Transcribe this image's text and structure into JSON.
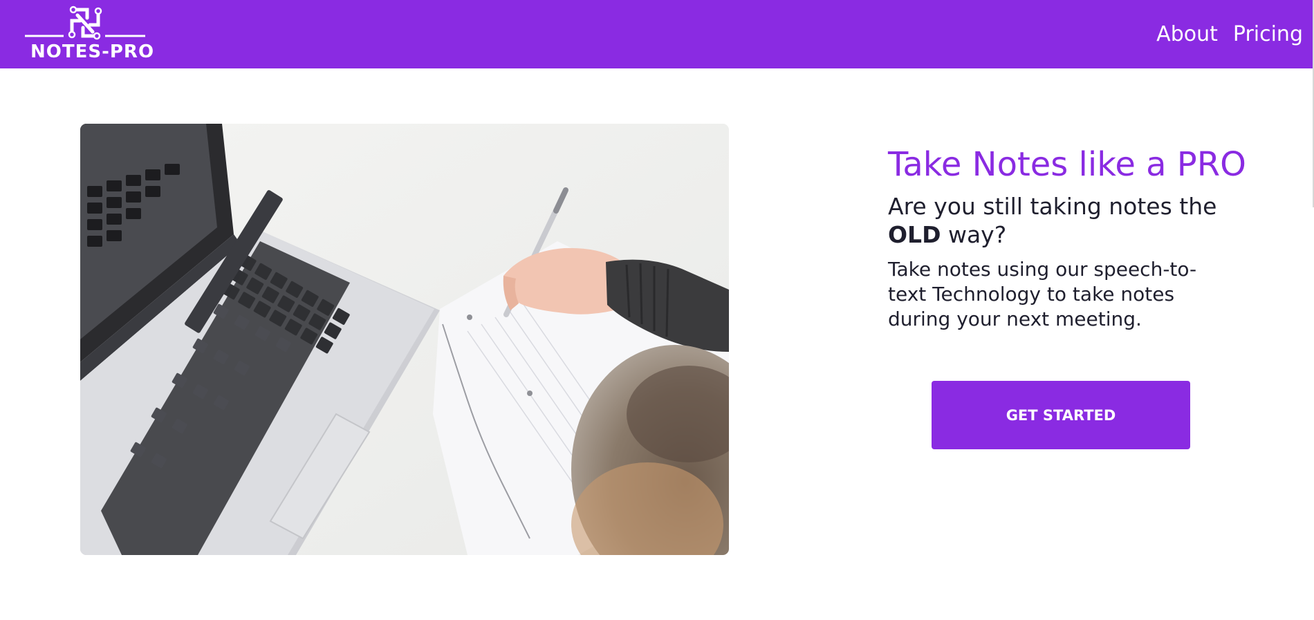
{
  "theme": {
    "brand_color": "#8a2be2",
    "text_color": "#1f1f2e",
    "background": "#ffffff"
  },
  "header": {
    "logo_text": "NOTES-PRO",
    "logo_icon": "pinwheel-icon",
    "nav": [
      {
        "label": "About"
      },
      {
        "label": "Pricing"
      }
    ]
  },
  "hero": {
    "image_icon": "laptop-notes-photo",
    "title": "Take Notes like a PRO",
    "subtitle_pre": "Are you still taking notes the ",
    "subtitle_bold": "OLD",
    "subtitle_post": " way?",
    "body": "Take notes using our speech-to-text Technology to take notes during your next meeting.",
    "cta_label": "GET STARTED"
  }
}
